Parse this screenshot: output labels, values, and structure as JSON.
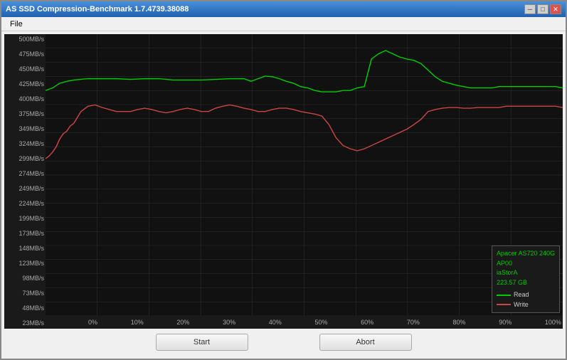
{
  "window": {
    "title": "AS SSD Compression-Benchmark 1.7.4739.38088",
    "menu": {
      "file_label": "File"
    }
  },
  "chart": {
    "y_labels": [
      "500MB/s",
      "475MB/s",
      "450MB/s",
      "425MB/s",
      "400MB/s",
      "375MB/s",
      "349MB/s",
      "324MB/s",
      "299MB/s",
      "274MB/s",
      "249MB/s",
      "224MB/s",
      "199MB/s",
      "173MB/s",
      "148MB/s",
      "123MB/s",
      "98MB/s",
      "73MB/s",
      "48MB/s",
      "23MB/s"
    ],
    "x_labels": [
      "0%",
      "10%",
      "20%",
      "30%",
      "40%",
      "50%",
      "60%",
      "70%",
      "80%",
      "90%",
      "100%"
    ],
    "legend": {
      "device_name": "Apacer AS720 240G",
      "device_id": "AP00",
      "driver": "iaStorA",
      "size": "223.57 GB",
      "read_label": "Read",
      "write_label": "Write"
    }
  },
  "buttons": {
    "start_label": "Start",
    "abort_label": "Abort"
  },
  "title_buttons": {
    "minimize": "─",
    "maximize": "□",
    "close": "✕"
  }
}
